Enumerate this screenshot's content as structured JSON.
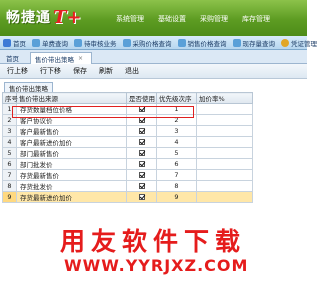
{
  "app": {
    "logo_text": "畅捷通",
    "logo_suffix": "T+",
    "menu": [
      "系统管理",
      "基础设置",
      "采购管理",
      "库存管理"
    ]
  },
  "module_bar": [
    "首页",
    "单费查询",
    "待审核业务",
    "采购价格查询",
    "销售价格查询",
    "现存量查询",
    "凭证管理"
  ],
  "tabs": {
    "home": "首页",
    "active": "售价带出策略",
    "close": "×"
  },
  "toolbar": [
    "行上移",
    "行下移",
    "保存",
    "刷新",
    "退出"
  ],
  "sub_tab": "售价带出策略",
  "grid": {
    "columns": [
      "序号",
      "售价带出来源",
      "是否使用",
      "优先级次序",
      "加价率%"
    ],
    "rows": [
      {
        "no": "1",
        "source": "存货数量档位价格",
        "used": true,
        "priority": "1",
        "markup": "",
        "highlight": false
      },
      {
        "no": "2",
        "source": "客户协议价",
        "used": true,
        "priority": "2",
        "markup": "",
        "highlight": false
      },
      {
        "no": "3",
        "source": "客户最新售价",
        "used": true,
        "priority": "3",
        "markup": "",
        "highlight": false
      },
      {
        "no": "4",
        "source": "客户最新进价加价",
        "used": true,
        "priority": "4",
        "markup": "",
        "highlight": false
      },
      {
        "no": "5",
        "source": "部门最新售价",
        "used": true,
        "priority": "5",
        "markup": "",
        "highlight": false
      },
      {
        "no": "6",
        "source": "部门批发价",
        "used": true,
        "priority": "6",
        "markup": "",
        "highlight": false
      },
      {
        "no": "7",
        "source": "存货最新售价",
        "used": true,
        "priority": "7",
        "markup": "",
        "highlight": false
      },
      {
        "no": "8",
        "source": "存货批发价",
        "used": true,
        "priority": "8",
        "markup": "",
        "highlight": false
      },
      {
        "no": "9",
        "source": "存货最新进价加价",
        "used": true,
        "priority": "9",
        "markup": "",
        "highlight": true
      }
    ]
  },
  "watermark": {
    "title": "用友软件下载",
    "url": "WWW.YYRJXZ.COM"
  },
  "colors": {
    "brand_green": "#5d9c22",
    "highlight": "#ffe7a8",
    "annotation_red": "#e02020",
    "watermark_red": "#e51c1c"
  }
}
